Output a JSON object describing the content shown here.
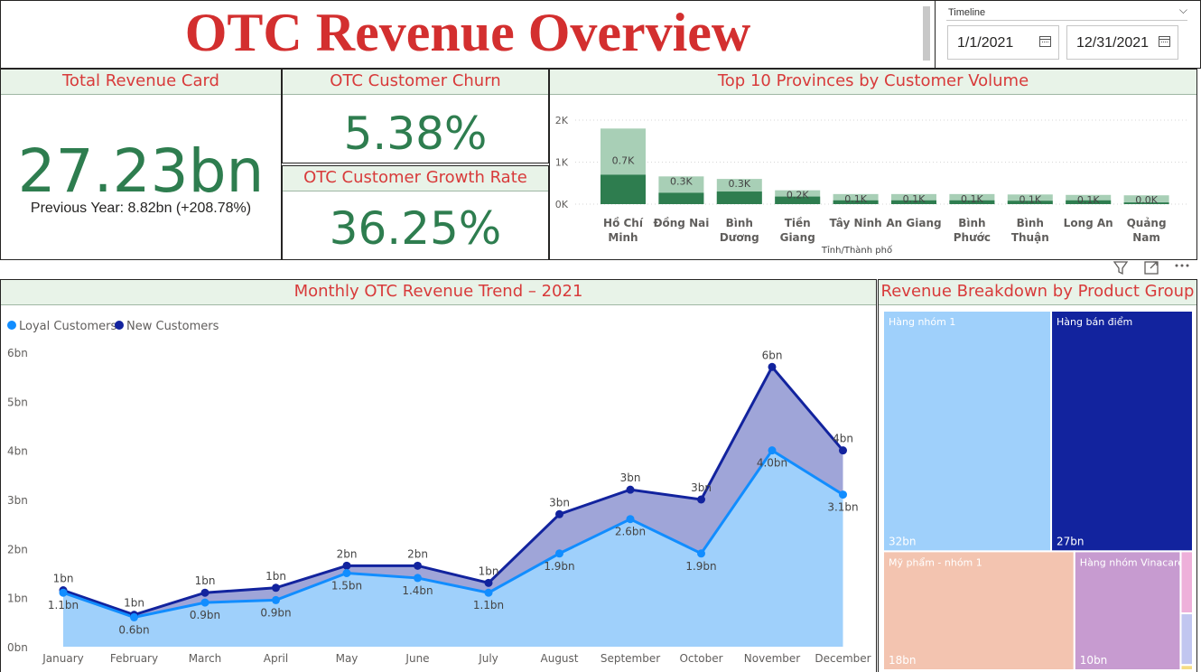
{
  "title": "OTC Revenue Overview",
  "timeline": {
    "label": "Timeline",
    "start": "1/1/2021",
    "end": "12/31/2021"
  },
  "total_revenue": {
    "title": "Total Revenue Card",
    "value": "27.23bn",
    "previous": "Previous Year: 8.82bn (+208.78%)"
  },
  "churn": {
    "title": "OTC Customer Churn",
    "value": "5.38%"
  },
  "growth": {
    "title": "OTC Customer Growth Rate",
    "value": "36.25%"
  },
  "provinces": {
    "title": "Top 10 Provinces by Customer Volume"
  },
  "trend": {
    "title": "Monthly OTC Revenue Trend – 2021"
  },
  "treemap": {
    "title": "Revenue Breakdown by Product Group"
  },
  "colors": {
    "accent_red": "#d83a3a",
    "kpi_green": "#2e7d4f",
    "bar_dark": "#2e7d4f",
    "bar_light": "#a8cfb6",
    "loyal": "#118dff",
    "new": "#12239e"
  },
  "chart_data": [
    {
      "type": "bar",
      "title": "Top 10 Provinces by Customer Volume",
      "xlabel": "Tỉnh/Thành phố",
      "ylabel": "",
      "categories": [
        "Hồ Chí Minh",
        "Đồng Nai",
        "Bình Dương",
        "Tiền Giang",
        "Tây Ninh",
        "An Giang",
        "Bình Phước",
        "Bình Thuận",
        "Long An",
        "Quảng Nam"
      ],
      "series": [
        {
          "values": [
            0.7,
            0.27,
            0.3,
            0.18,
            0.09,
            0.09,
            0.09,
            0.08,
            0.09,
            0.04
          ]
        },
        {
          "values": [
            1.8,
            0.66,
            0.6,
            0.33,
            0.24,
            0.24,
            0.24,
            0.23,
            0.22,
            0.21
          ]
        }
      ],
      "data_labels": [
        "0.7K",
        "0.3K",
        "0.3K",
        "0.2K",
        "0.1K",
        "0.1K",
        "0.1K",
        "0.1K",
        "0.1K",
        "0.0K"
      ],
      "yticks": [
        "0K",
        "1K",
        "2K"
      ],
      "ylim": [
        0,
        2.2
      ]
    },
    {
      "type": "area",
      "title": "Monthly OTC Revenue Trend – 2021",
      "categories": [
        "January",
        "February",
        "March",
        "April",
        "May",
        "June",
        "July",
        "August",
        "September",
        "October",
        "November",
        "December"
      ],
      "series": [
        {
          "name": "Loyal Customers",
          "values": [
            1.1,
            0.6,
            0.9,
            0.95,
            1.5,
            1.4,
            1.1,
            1.9,
            2.6,
            1.9,
            4.0,
            3.1
          ],
          "labels": [
            "1.1bn",
            "0.6bn",
            "0.9bn",
            "0.9bn",
            "1.5bn",
            "1.4bn",
            "1.1bn",
            "1.9bn",
            "2.6bn",
            "1.9bn",
            "4.0bn",
            "3.1bn"
          ]
        },
        {
          "name": "New Customers",
          "values": [
            1.15,
            0.65,
            1.1,
            1.2,
            1.65,
            1.65,
            1.3,
            2.7,
            3.2,
            3.0,
            5.7,
            4.0
          ],
          "labels": [
            "1bn",
            "1bn",
            "1bn",
            "1bn",
            "2bn",
            "2bn",
            "1bn",
            "3bn",
            "3bn",
            "3bn",
            "6bn",
            "4bn"
          ]
        }
      ],
      "yticks": [
        "0bn",
        "1bn",
        "2bn",
        "3bn",
        "4bn",
        "5bn",
        "6bn"
      ],
      "ylim": [
        0,
        6
      ],
      "legend": "top-left"
    },
    {
      "type": "treemap",
      "title": "Revenue Breakdown by Product Group",
      "items": [
        {
          "name": "Hàng nhóm 1",
          "value": 32,
          "label": "32bn",
          "color": "#9fd0fb"
        },
        {
          "name": "Hàng bán điểm",
          "value": 27,
          "label": "27bn",
          "color": "#12239e"
        },
        {
          "name": "Mỹ phẩm - nhóm 1",
          "value": 18,
          "label": "18bn",
          "color": "#f3c4b0"
        },
        {
          "name": "Hàng nhóm Vinacare",
          "value": 10,
          "label": "10bn",
          "color": "#c79bd0"
        },
        {
          "name": "",
          "value": 0.6,
          "label": "",
          "color": "#eeb0da"
        },
        {
          "name": "",
          "value": 0.5,
          "label": "",
          "color": "#c1c6f0"
        },
        {
          "name": "",
          "value": 0.05,
          "label": "",
          "color": "#f5dc84"
        }
      ]
    }
  ]
}
